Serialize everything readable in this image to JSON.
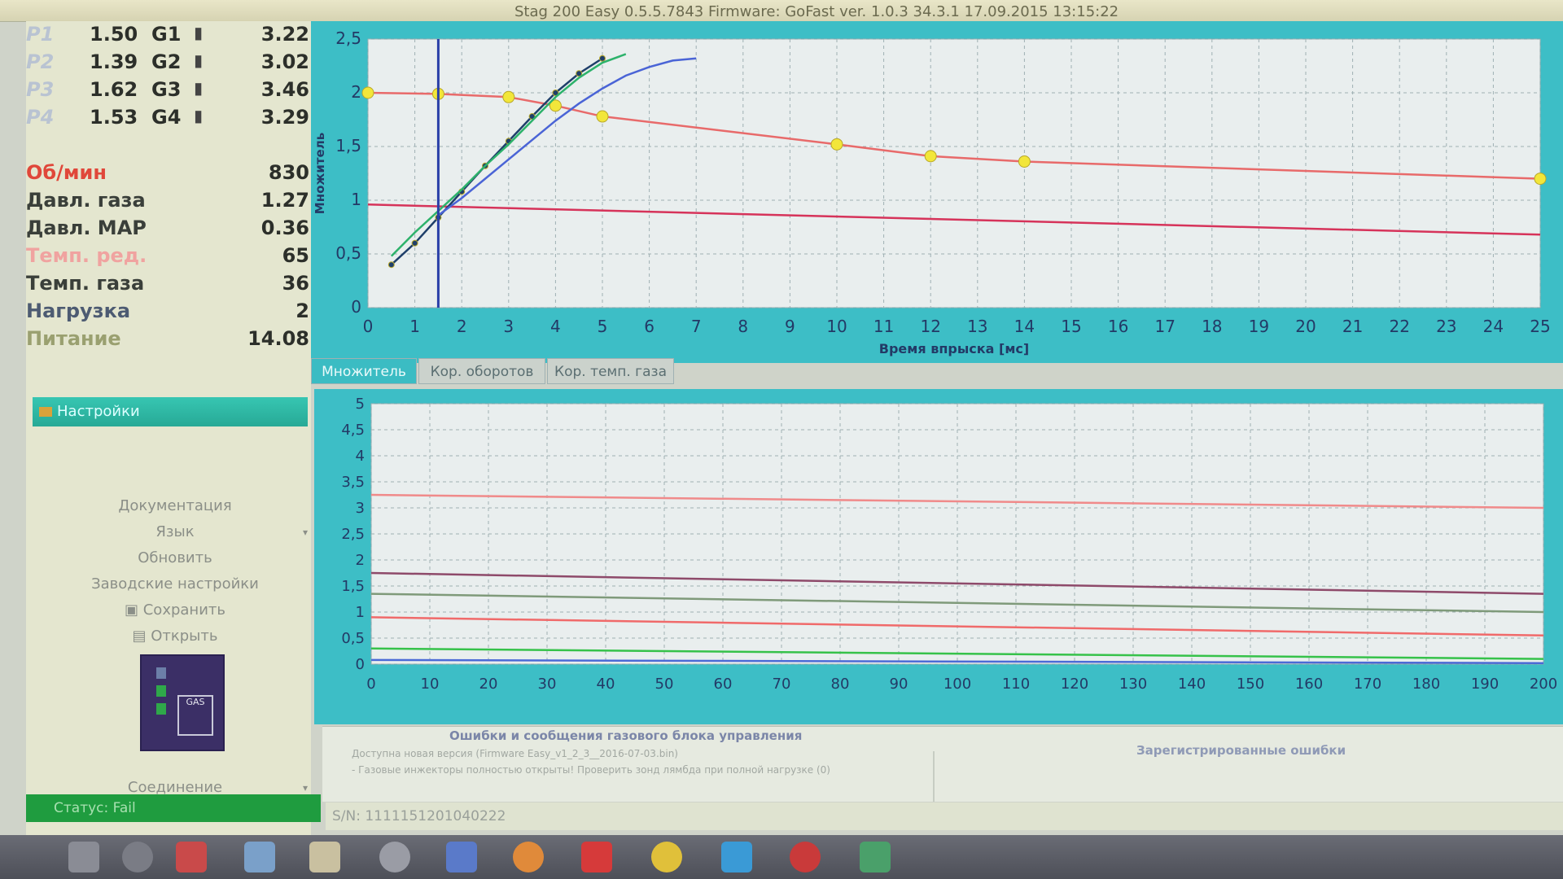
{
  "window": {
    "title": "Stag 200 Easy 0.5.5.7843 Firmware: GoFast  ver. 1.0.3  34.3.1   17.09.2015 13:15:22"
  },
  "sensors": [
    {
      "p": "P1",
      "value": "1.50",
      "g": "G1",
      "gvalue": "3.22"
    },
    {
      "p": "P2",
      "value": "1.39",
      "g": "G2",
      "gvalue": "3.02"
    },
    {
      "p": "P3",
      "value": "1.62",
      "g": "G3",
      "gvalue": "3.46"
    },
    {
      "p": "P4",
      "value": "1.53",
      "g": "G4",
      "gvalue": "3.29"
    }
  ],
  "params": [
    {
      "label": "Об/мин",
      "value": "830",
      "color": "#e0473a"
    },
    {
      "label": "Давл. газа",
      "value": "1.27",
      "color": "#3a3f3a"
    },
    {
      "label": "Давл. MAP",
      "value": "0.36",
      "color": "#3a3f3a"
    },
    {
      "label": "Темп. ред.",
      "value": "65",
      "color": "#f0a3a0"
    },
    {
      "label": "Темп. газа",
      "value": "36",
      "color": "#3a3f3a"
    },
    {
      "label": "Нагрузка",
      "value": "2",
      "color": "#4d5b72"
    },
    {
      "label": "Питание",
      "value": "14.08",
      "color": "#9aa070"
    }
  ],
  "settings": {
    "header": "Настройки",
    "items": [
      "Документация",
      "Язык",
      "Обновить",
      "Заводские настройки",
      "Сохранить",
      "Открыть"
    ],
    "connection": "Соединение",
    "logo_text": "GAS"
  },
  "status": {
    "text": "Статус: Fail"
  },
  "serial": {
    "text": "S/N: 1111151201040222"
  },
  "tabs": [
    "Множитель",
    "Кор. оборотов",
    "Кор. темп. газа"
  ],
  "errors": {
    "header": "Ошибки и сообщения газового блока управления",
    "line1": "Доступна новая версия (Firmware Easy_v1_2_3__2016-07-03.bin)",
    "line2": "- Газовые инжекторы полностью открыты! Проверить зонд лямбда при полной нагрузке (0)",
    "registered": "Зарегистрированные ошибки"
  },
  "chart_data": [
    {
      "type": "line",
      "title": "",
      "xlabel": "Время впрыска [мс]",
      "ylabel": "Множитель",
      "xlim": [
        0,
        25
      ],
      "ylim": [
        0,
        2.5
      ],
      "x_ticks": [
        0,
        1,
        2,
        3,
        4,
        5,
        6,
        7,
        8,
        9,
        10,
        11,
        12,
        13,
        14,
        15,
        16,
        17,
        18,
        19,
        20,
        21,
        22,
        23,
        24,
        25
      ],
      "y_ticks": [
        0,
        0.5,
        1,
        1.5,
        2,
        2.5
      ],
      "y_tick_labels": [
        "0",
        "0,5",
        "1",
        "1,5",
        "2",
        "2,5"
      ],
      "series": [
        {
          "color": "#e86a6a",
          "x": [
            0,
            1.5,
            3,
            4,
            5,
            10,
            12,
            14,
            25
          ],
          "y": [
            2.0,
            1.99,
            1.96,
            1.88,
            1.78,
            1.52,
            1.41,
            1.36,
            1.2
          ],
          "markers": true
        },
        {
          "color": "#d6335a",
          "x": [
            0,
            25
          ],
          "y": [
            0.96,
            0.68
          ],
          "markers": false
        },
        {
          "color": "#1f3f6a",
          "x": [
            0.5,
            1,
            1.5,
            2,
            2.5,
            3,
            3.5,
            4,
            4.5,
            5
          ],
          "y": [
            0.4,
            0.6,
            0.84,
            1.08,
            1.32,
            1.55,
            1.78,
            2.0,
            2.18,
            2.32
          ],
          "markers": true
        },
        {
          "color": "#2db26b",
          "x": [
            0.5,
            1,
            1.5,
            2,
            2.5,
            3,
            3.5,
            4,
            4.5,
            5,
            5.5
          ],
          "y": [
            0.48,
            0.7,
            0.9,
            1.1,
            1.32,
            1.52,
            1.74,
            1.96,
            2.14,
            2.28,
            2.36
          ],
          "markers": false
        },
        {
          "color": "#4a64d6",
          "x": [
            1.5,
            2,
            2.5,
            3,
            3.5,
            4,
            4.5,
            5,
            5.5,
            6,
            6.5,
            7
          ],
          "y": [
            0.86,
            1.02,
            1.2,
            1.38,
            1.56,
            1.74,
            1.9,
            2.04,
            2.16,
            2.24,
            2.3,
            2.32
          ],
          "markers": false
        }
      ],
      "cursor_x": 1.5
    },
    {
      "type": "line",
      "title": "",
      "xlim": [
        0,
        200
      ],
      "ylim": [
        0,
        5
      ],
      "x_ticks": [
        0,
        10,
        20,
        30,
        40,
        50,
        60,
        70,
        80,
        90,
        100,
        110,
        120,
        130,
        140,
        150,
        160,
        170,
        180,
        190,
        200
      ],
      "y_ticks": [
        0,
        0.5,
        1,
        1.5,
        2,
        2.5,
        3,
        3.5,
        4,
        4.5,
        5
      ],
      "y_tick_labels": [
        "0",
        "0,5",
        "1",
        "1,5",
        "2",
        "2,5",
        "3",
        "3,5",
        "4",
        "4,5",
        "5"
      ],
      "series": [
        {
          "color": "#f08a8a",
          "x": [
            0,
            200
          ],
          "y": [
            3.25,
            3.0
          ]
        },
        {
          "color": "#8e4a6a",
          "x": [
            0,
            200
          ],
          "y": [
            1.75,
            1.35
          ]
        },
        {
          "color": "#7f9a7a",
          "x": [
            0,
            200
          ],
          "y": [
            1.35,
            1.0
          ]
        },
        {
          "color": "#f06a6a",
          "x": [
            0,
            200
          ],
          "y": [
            0.9,
            0.55
          ]
        },
        {
          "color": "#36c24a",
          "x": [
            0,
            200
          ],
          "y": [
            0.3,
            0.1
          ]
        },
        {
          "color": "#4a6ad6",
          "x": [
            0,
            200
          ],
          "y": [
            0.08,
            0.02
          ]
        }
      ]
    }
  ]
}
